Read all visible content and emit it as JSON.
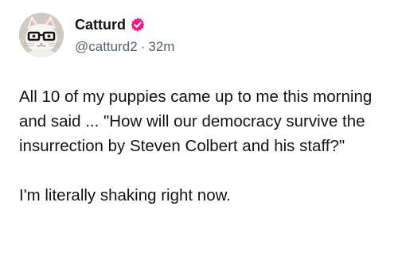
{
  "post": {
    "author": {
      "name": "Catturd",
      "handle": "@catturd2",
      "separator": "·",
      "timestamp": "32m",
      "avatar_icon": "cat-with-glasses-avatar",
      "verified_icon": "verified-badge-icon",
      "verified_color": "#f91880"
    },
    "text": {
      "paragraph_1": "All 10 of my puppies came up to me this morning and said ... \"How will our democracy survive the insurrection by Steven Colbert and his staff?\"",
      "paragraph_2": "I'm literally shaking right now."
    }
  }
}
